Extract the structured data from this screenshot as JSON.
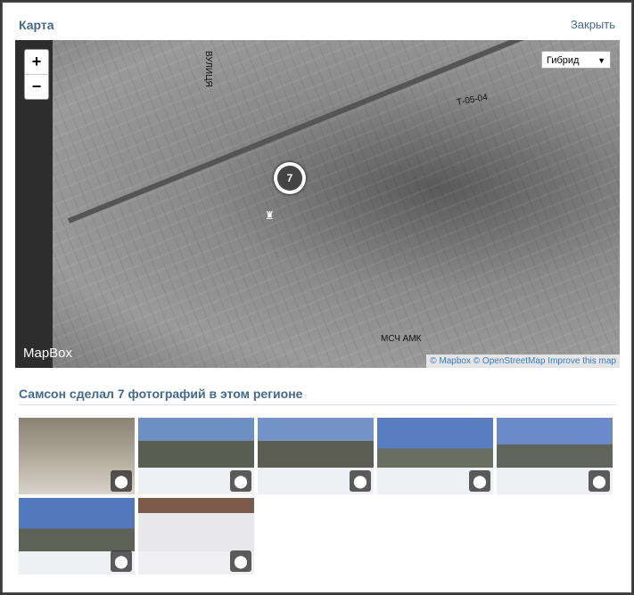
{
  "header": {
    "title": "Карта",
    "close_label": "Закрыть"
  },
  "map": {
    "zoom_in": "+",
    "zoom_out": "−",
    "layer_select": "Гибрид",
    "labels": [
      "ВУЛИЦЯ",
      "Т-05-04",
      "МСЧ АМК"
    ],
    "cluster_count": "7",
    "brand": "MapBox",
    "attribution": {
      "mapbox": "© Mapbox",
      "osm": "© OpenStreetMap",
      "improve": "Improve this map"
    }
  },
  "photos": {
    "heading": "Самсон сделал 7 фотографий в этом регионе",
    "count": 7,
    "pin_icon": "map-pin-icon"
  }
}
